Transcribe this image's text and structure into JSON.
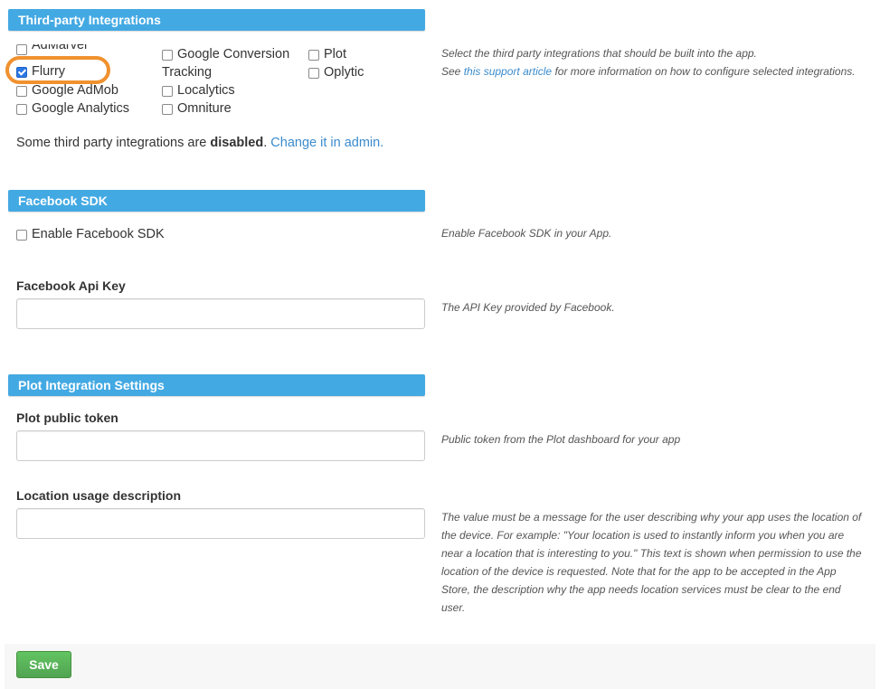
{
  "third_party": {
    "header": "Third-party Integrations",
    "options": [
      {
        "label": "AdMarvel",
        "checked": false
      },
      {
        "label": "Flurry",
        "checked": true
      },
      {
        "label": "Google AdMob",
        "checked": false
      },
      {
        "label": "Google Analytics",
        "checked": false
      },
      {
        "label": "Google Conversion Tracking",
        "checked": false
      },
      {
        "label": "Localytics",
        "checked": false
      },
      {
        "label": "Omniture",
        "checked": false
      },
      {
        "label": "Plot",
        "checked": false
      },
      {
        "label": "Oplytic",
        "checked": false
      }
    ],
    "google_conversion_line1": "Google Conversion",
    "google_conversion_line2": "Tracking",
    "help_line1": "Select the third party integrations that should be built into the app.",
    "help_see": "See",
    "help_link": "this support article",
    "help_rest": "for more information on how to configure selected integrations.",
    "disabled_prefix": "Some third party integrations are",
    "disabled_word": "disabled",
    "disabled_period": ".",
    "admin_link": "Change it in admin."
  },
  "facebook": {
    "header": "Facebook SDK",
    "enable_label": "Enable Facebook SDK",
    "enable_checked": false,
    "enable_help": "Enable Facebook SDK in your App.",
    "api_key_label": "Facebook Api Key",
    "api_key_value": "",
    "api_key_help": "The API Key provided by Facebook."
  },
  "plot": {
    "header": "Plot Integration Settings",
    "token_label": "Plot public token",
    "token_value": "",
    "token_help": "Public token from the Plot dashboard for your app",
    "location_label": "Location usage description",
    "location_value": "",
    "location_help_lines": [
      "The value must be a message for the user describing why your app uses the location of",
      "the device. For example: \"Your location is used to instantly inform you when you are",
      "near a location that is interesting to you.\" This text is shown when permission to use the",
      "location of the device is requested. Note that for the app to be accepted in the App",
      "Store, the description why the app needs location services must be clear to the end",
      "user."
    ]
  },
  "actions": {
    "save_label": "Save"
  },
  "colors": {
    "header_bg": "#43a9e3",
    "link": "#3a8bcd",
    "highlight": "#f0912f",
    "save_bg": "#5cb85c"
  }
}
